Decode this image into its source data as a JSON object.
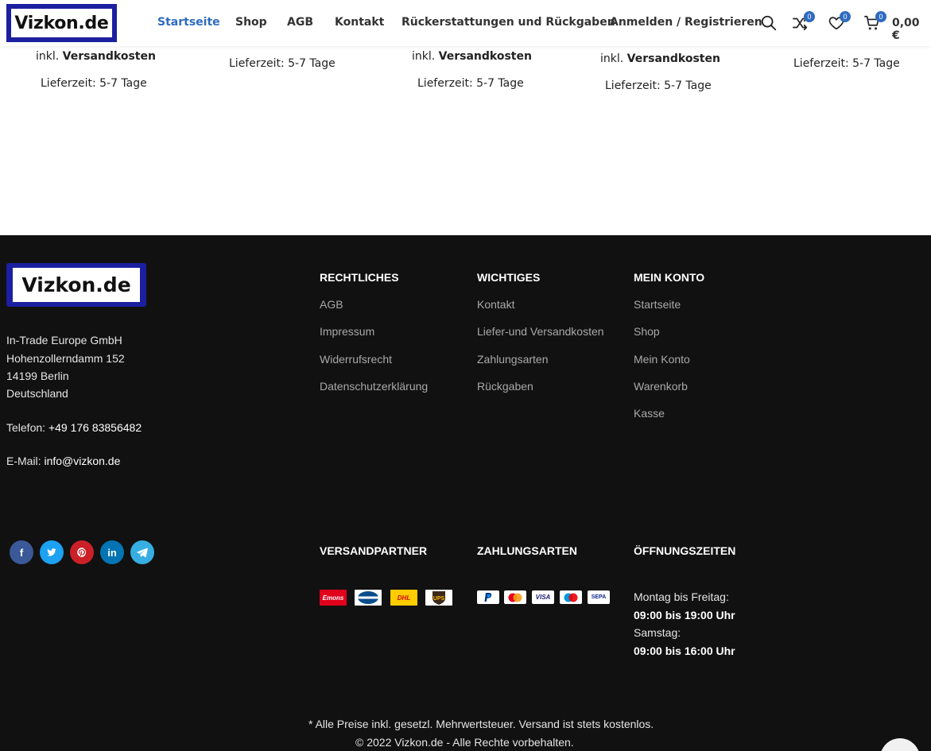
{
  "header": {
    "logo_text": "Vizkon.de",
    "nav": [
      "Startseite",
      "Shop",
      "AGB",
      "Kontakt",
      "Rückerstattungen und Rückgaben",
      "Anmelden / Registrieren"
    ],
    "compare_count": "0",
    "wishlist_count": "0",
    "cart_count": "0",
    "cart_total": "0,00 €",
    "accent_color": "#2e6bbf"
  },
  "products": {
    "shipping_prefix": "inkl.",
    "shipping_label": "Versandkosten",
    "delivery": "Lieferzeit: 5-7 Tage"
  },
  "footer": {
    "logo_text": "Vizkon.de",
    "company": "In-Trade Europe GmbH",
    "street": "Hohenzollerndamm 152",
    "city": "14199 Berlin",
    "country": "Deutschland",
    "phone_label": "Telefon:",
    "phone": "+49 176 83856482",
    "email_label": "E-Mail:",
    "email": "info@vizkon.de",
    "rechtliches": {
      "title": "RECHTLICHES",
      "links": [
        "AGB",
        "Impressum",
        "Widerrufsrecht",
        "Datenschutzerklärung"
      ]
    },
    "wichtiges": {
      "title": "WICHTIGES",
      "links": [
        "Kontakt",
        "Liefer-und Versandkosten",
        "Zahlungsarten",
        "Rückgaben"
      ]
    },
    "konto": {
      "title": "MEIN KONTO",
      "links": [
        "Startseite",
        "Shop",
        "Mein Konto",
        "Warenkorb",
        "Kasse"
      ]
    },
    "social": [
      "facebook-icon",
      "twitter-icon",
      "pinterest-icon",
      "linkedin-icon",
      "telegram-icon"
    ],
    "versand_title": "VERSANDPARTNER",
    "shipping_partners": [
      "Emons",
      "GO! Express",
      "DHL",
      "UPS"
    ],
    "zahlung_title": "ZAHLUNGSARTEN",
    "payment_methods": [
      "PayPal",
      "Mastercard",
      "VISA",
      "Maestro",
      "SEPA"
    ],
    "hours_title": "ÖFFNUNGSZEITEN",
    "weekday_label": "Montag bis Freitag:",
    "weekday_hours": "09:00 bis 19:00 Uhr",
    "saturday_label": "Samstag:",
    "saturday_hours": "09:00 bis 16:00 Uhr",
    "note": "* Alle Preise inkl. gesetzl. Mehrwertsteuer. Versand ist stets kostenlos.",
    "copyright": "© 2022 Vizkon.de - Alle Rechte vorbehalten."
  }
}
